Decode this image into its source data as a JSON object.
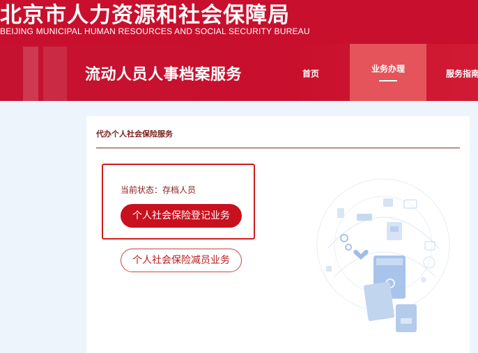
{
  "header": {
    "site_title": "北京市人力资源和社会保障局",
    "site_subtitle": "BEIJING MUNICIPAL HUMAN RESOURCES AND SOCIAL SECURITY BUREAU"
  },
  "nav": {
    "service_title": "流动人员人事档案服务",
    "items": [
      {
        "label": "首页"
      },
      {
        "label": "业务办理"
      },
      {
        "label": "服务指南"
      }
    ],
    "active_index": 1
  },
  "panel": {
    "title": "代办个人社会保险服务",
    "status_text": "当前状态：存档人员",
    "primary_button": "个人社会保险登记业务",
    "secondary_button": "个人社会保险减员业务"
  },
  "colors": {
    "brand_red": "#c8102e",
    "active_tab": "#e4545a",
    "background": "#eef4fb"
  }
}
